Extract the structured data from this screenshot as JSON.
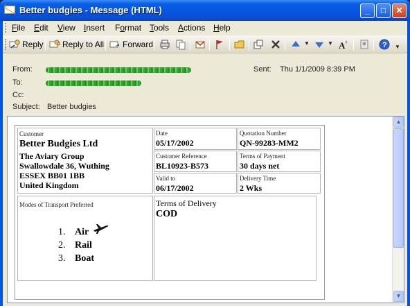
{
  "window": {
    "title": "Better budgies - Message (HTML)",
    "controls": {
      "minimize": "_",
      "maximize": "□",
      "close": "✕"
    }
  },
  "menu": [
    {
      "label": "File",
      "accel": "F"
    },
    {
      "label": "Edit",
      "accel": "E"
    },
    {
      "label": "View",
      "accel": "V"
    },
    {
      "label": "Insert",
      "accel": "I"
    },
    {
      "label": "Format",
      "accel": "o"
    },
    {
      "label": "Tools",
      "accel": "T"
    },
    {
      "label": "Actions",
      "accel": "A"
    },
    {
      "label": "Help",
      "accel": "H"
    }
  ],
  "toolbar": {
    "reply_label": "Reply",
    "reply_all_label": "Reply to All",
    "forward_label": "Forward",
    "icons": [
      "reply-icon",
      "reply-all-icon",
      "forward-icon",
      "print-icon",
      "copy-icon",
      "move-icon",
      "flag-icon",
      "open-icon",
      "move-to-folder-icon",
      "delete-icon",
      "previous-icon",
      "next-icon",
      "font-size-icon",
      "address-book-icon",
      "help-icon"
    ]
  },
  "header": {
    "from_label": "From:",
    "to_label": "To:",
    "cc_label": "Cc:",
    "subject_label": "Subject:",
    "subject_value": "Better budgies",
    "sent_label": "Sent:",
    "sent_value": "Thu 1/1/2009 8:39 PM"
  },
  "document": {
    "customer": {
      "label": "Customer",
      "name": "Better Budgies Ltd",
      "lines": [
        "The Aviary Group",
        "Swallowdale 36, Wuthing",
        "ESSEX BB01 1BB",
        "United Kingdom"
      ]
    },
    "date": {
      "label": "Date",
      "value": "05/17/2002"
    },
    "quotation": {
      "label": "Quotation Number",
      "value": "QN-99283-MM2"
    },
    "customer_reference": {
      "label": "Customer Reference",
      "value": "BL10923-B573"
    },
    "terms_of_payment": {
      "label": "Terms of Payment",
      "value": "30 days net"
    },
    "valid_to": {
      "label": "Valid to",
      "value": "06/17/2002"
    },
    "delivery_time": {
      "label": "Delivery Time",
      "value": "2 Wks"
    },
    "transport": {
      "label": "Modes of Transport Preferred",
      "items": [
        {
          "num": "1.",
          "mode": "Air"
        },
        {
          "num": "2.",
          "mode": "Rail"
        },
        {
          "num": "3.",
          "mode": "Boat"
        }
      ]
    },
    "terms_of_delivery": {
      "label": "Terms of Delivery",
      "value": "COD"
    }
  },
  "colors": {
    "titlebar": "#0a5fe4",
    "chrome": "#ece9d8",
    "redaction": "#2aa12a"
  }
}
